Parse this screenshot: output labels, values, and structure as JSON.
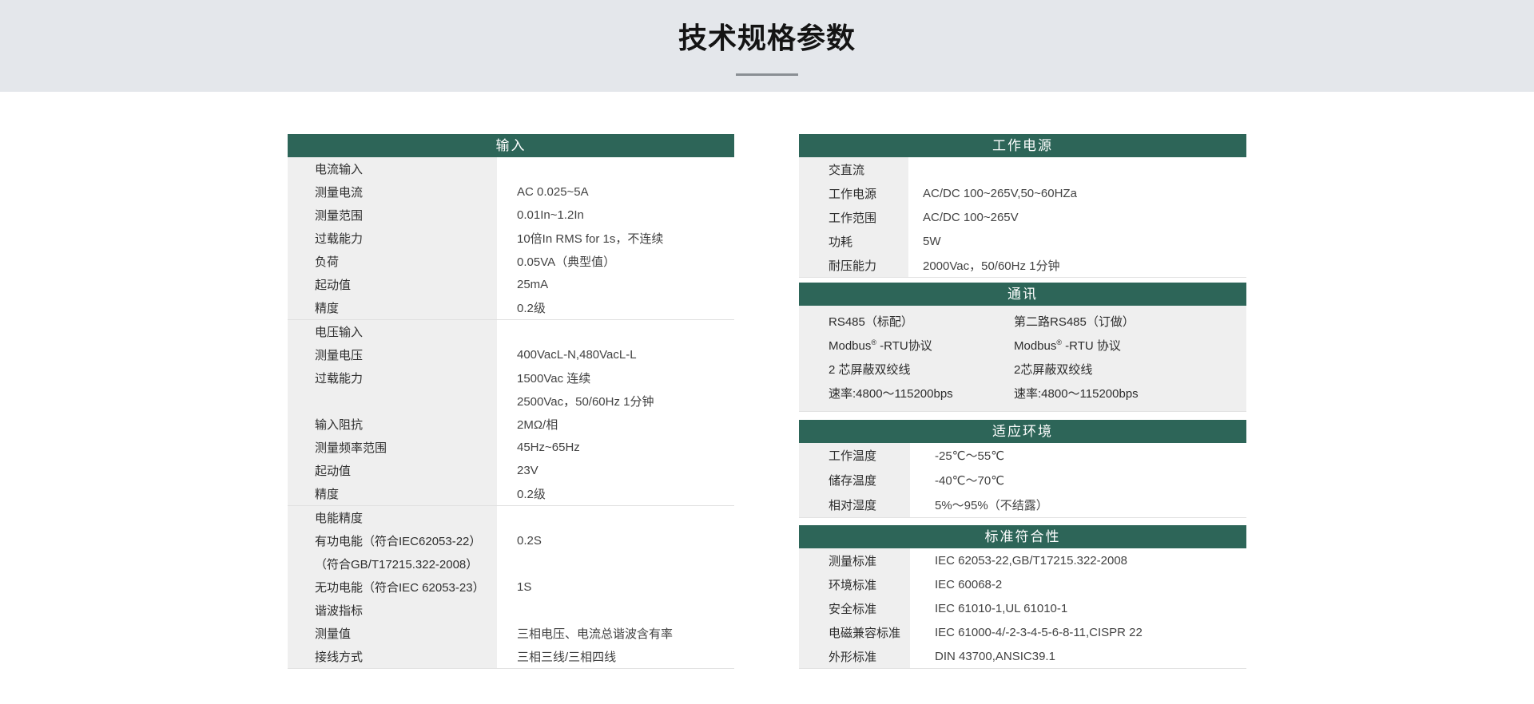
{
  "page": {
    "title": "技术规格参数"
  },
  "colors": {
    "header_green": "#2d6558",
    "top_band_gray": "#e4e7eb",
    "label_column_gray": "#efefef"
  },
  "input_table": {
    "title": "输入",
    "rows": [
      {
        "label": "电流输入",
        "value": ""
      },
      {
        "label": "测量电流",
        "value": "AC 0.025~5A"
      },
      {
        "label": "测量范围",
        "value": "0.01In~1.2In"
      },
      {
        "label": "过载能力",
        "value": "10倍In RMS for 1s，不连续"
      },
      {
        "label": "负荷",
        "value": "0.05VA（典型值）"
      },
      {
        "label": "起动值",
        "value": "25mA"
      },
      {
        "label": "精度",
        "value": "0.2级"
      },
      {
        "label": "电压输入",
        "value": ""
      },
      {
        "label": "测量电压",
        "value": "400VacL-N,480VacL-L"
      },
      {
        "label": "过载能力",
        "value": "1500Vac 连续"
      },
      {
        "label": "",
        "value": "2500Vac，50/60Hz 1分钟"
      },
      {
        "label": "输入阻抗",
        "value": "2MΩ/相"
      },
      {
        "label": "测量频率范围",
        "value": "45Hz~65Hz"
      },
      {
        "label": "起动值",
        "value": "23V"
      },
      {
        "label": "精度",
        "value": "0.2级"
      },
      {
        "label": "电能精度",
        "value": ""
      },
      {
        "label": "有功电能（符合IEC62053-22）",
        "value": "0.2S"
      },
      {
        "label": "（符合GB/T17215.322-2008）",
        "value": ""
      },
      {
        "label": "无功电能（符合IEC 62053-23）",
        "value": "1S"
      },
      {
        "label": "谐波指标",
        "value": ""
      },
      {
        "label": "测量值",
        "value": "三相电压、电流总谐波含有率"
      },
      {
        "label": "接线方式",
        "value": "三相三线/三相四线"
      }
    ]
  },
  "power_table": {
    "title": "工作电源",
    "rows": [
      {
        "label": "交直流",
        "value": ""
      },
      {
        "label": "工作电源",
        "value": "AC/DC 100~265V,50~60HZa"
      },
      {
        "label": "工作范围",
        "value": "AC/DC 100~265V"
      },
      {
        "label": "功耗",
        "value": "5W"
      },
      {
        "label": "耐压能力",
        "value": "2000Vac，50/60Hz 1分钟"
      }
    ]
  },
  "comm_table": {
    "title": "通讯",
    "channels": [
      {
        "name": "RS485（标配）",
        "protocol_name": "Modbus",
        "trademark": "®",
        "protocol_rest": " -RTU协议",
        "wire": "2 芯屏蔽双绞线",
        "rate": "速率:4800～115200bps"
      },
      {
        "name": "第二路RS485（订做）",
        "protocol_name": "Modbus",
        "trademark": "®",
        "protocol_rest": " -RTU 协议",
        "wire": "2芯屏蔽双绞线",
        "rate": "速率:4800～115200bps"
      }
    ]
  },
  "env_table": {
    "title": "适应环境",
    "rows": [
      {
        "label": "工作温度",
        "value": "-25℃～55℃"
      },
      {
        "label": "储存温度",
        "value": "-40℃～70℃"
      },
      {
        "label": "相对湿度",
        "value": "5%～95%（不结露）"
      }
    ]
  },
  "standards_table": {
    "title": "标准符合性",
    "rows": [
      {
        "label": "测量标准",
        "value": "IEC 62053-22,GB/T17215.322-2008"
      },
      {
        "label": "环境标准",
        "value": "IEC 60068-2"
      },
      {
        "label": "安全标准",
        "value": "IEC 61010-1,UL 61010-1"
      },
      {
        "label": "电磁兼容标准",
        "value": "IEC 61000-4/-2-3-4-5-6-8-11,CISPR 22"
      },
      {
        "label": "外形标准",
        "value": "DIN 43700,ANSIC39.1"
      }
    ]
  }
}
